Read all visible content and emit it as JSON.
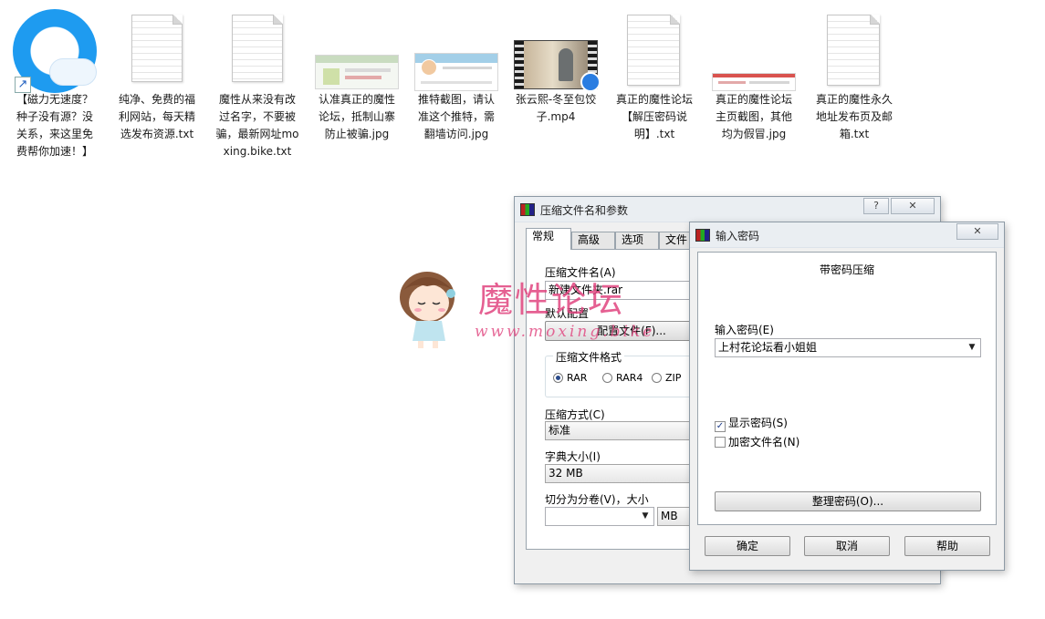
{
  "desktop_icons": [
    {
      "label": "【磁力无速度？种子没有源？没关系，来这里免费帮你加速！】",
      "icon": "qq-browser-shortcut-icon"
    },
    {
      "label": "纯净、免费的福利网站，每天精选发布资源.txt",
      "icon": "text-file-icon"
    },
    {
      "label": "魔性从来没有改过名字，不要被骗，最新网址moxing.bike.txt",
      "icon": "text-file-icon"
    },
    {
      "label": "认准真正的魔性论坛，抵制山寨防止被骗.jpg",
      "icon": "image-file-icon"
    },
    {
      "label": "推特截图，请认准这个推特，需翻墙访问.jpg",
      "icon": "image-file-icon"
    },
    {
      "label": "张云熙-冬至包饺子.mp4",
      "icon": "video-file-icon"
    },
    {
      "label": "真正的魔性论坛【解压密码说明】.txt",
      "icon": "text-file-icon"
    },
    {
      "label": "真正的魔性论坛主页截图，其他均为假冒.jpg",
      "icon": "image-file-icon"
    },
    {
      "label": "真正的魔性永久地址发布页及邮箱.txt",
      "icon": "text-file-icon"
    }
  ],
  "compress_window": {
    "title": "压缩文件名和参数",
    "help_glyph": "?",
    "close_glyph": "✕",
    "tabs": [
      "常规",
      "高级",
      "选项",
      "文件"
    ],
    "archive_name_label": "压缩文件名(A)",
    "archive_name_value": "新建文件夹.rar",
    "default_profile_label": "默认配置",
    "profile_button": "配置文件(F)...",
    "format_group": "压缩文件格式",
    "formats": [
      {
        "label": "RAR",
        "selected": true
      },
      {
        "label": "RAR4",
        "selected": false
      },
      {
        "label": "ZIP",
        "selected": false
      }
    ],
    "method_label": "压缩方式(C)",
    "method_value": "标准",
    "dict_label": "字典大小(I)",
    "dict_value": "32 MB",
    "split_label": "切分为分卷(V)，大小",
    "split_value": "",
    "split_unit": "MB"
  },
  "password_window": {
    "title": "输入密码",
    "close_glyph": "✕",
    "heading": "带密码压缩",
    "password_label": "输入密码(E)",
    "password_value": "上村花论坛看小姐姐",
    "show_password_label": "显示密码(S)",
    "show_password_checked": true,
    "encrypt_names_label": "加密文件名(N)",
    "encrypt_names_checked": false,
    "organize_button": "整理密码(O)...",
    "ok_button": "确定",
    "cancel_button": "取消",
    "help_button": "帮助"
  },
  "watermark": {
    "brand": "魔性论坛",
    "url": "www.moxing.bike"
  },
  "colors": {
    "watermark_pink": "#e1457f",
    "qq_blue": "#1e9bf0"
  }
}
